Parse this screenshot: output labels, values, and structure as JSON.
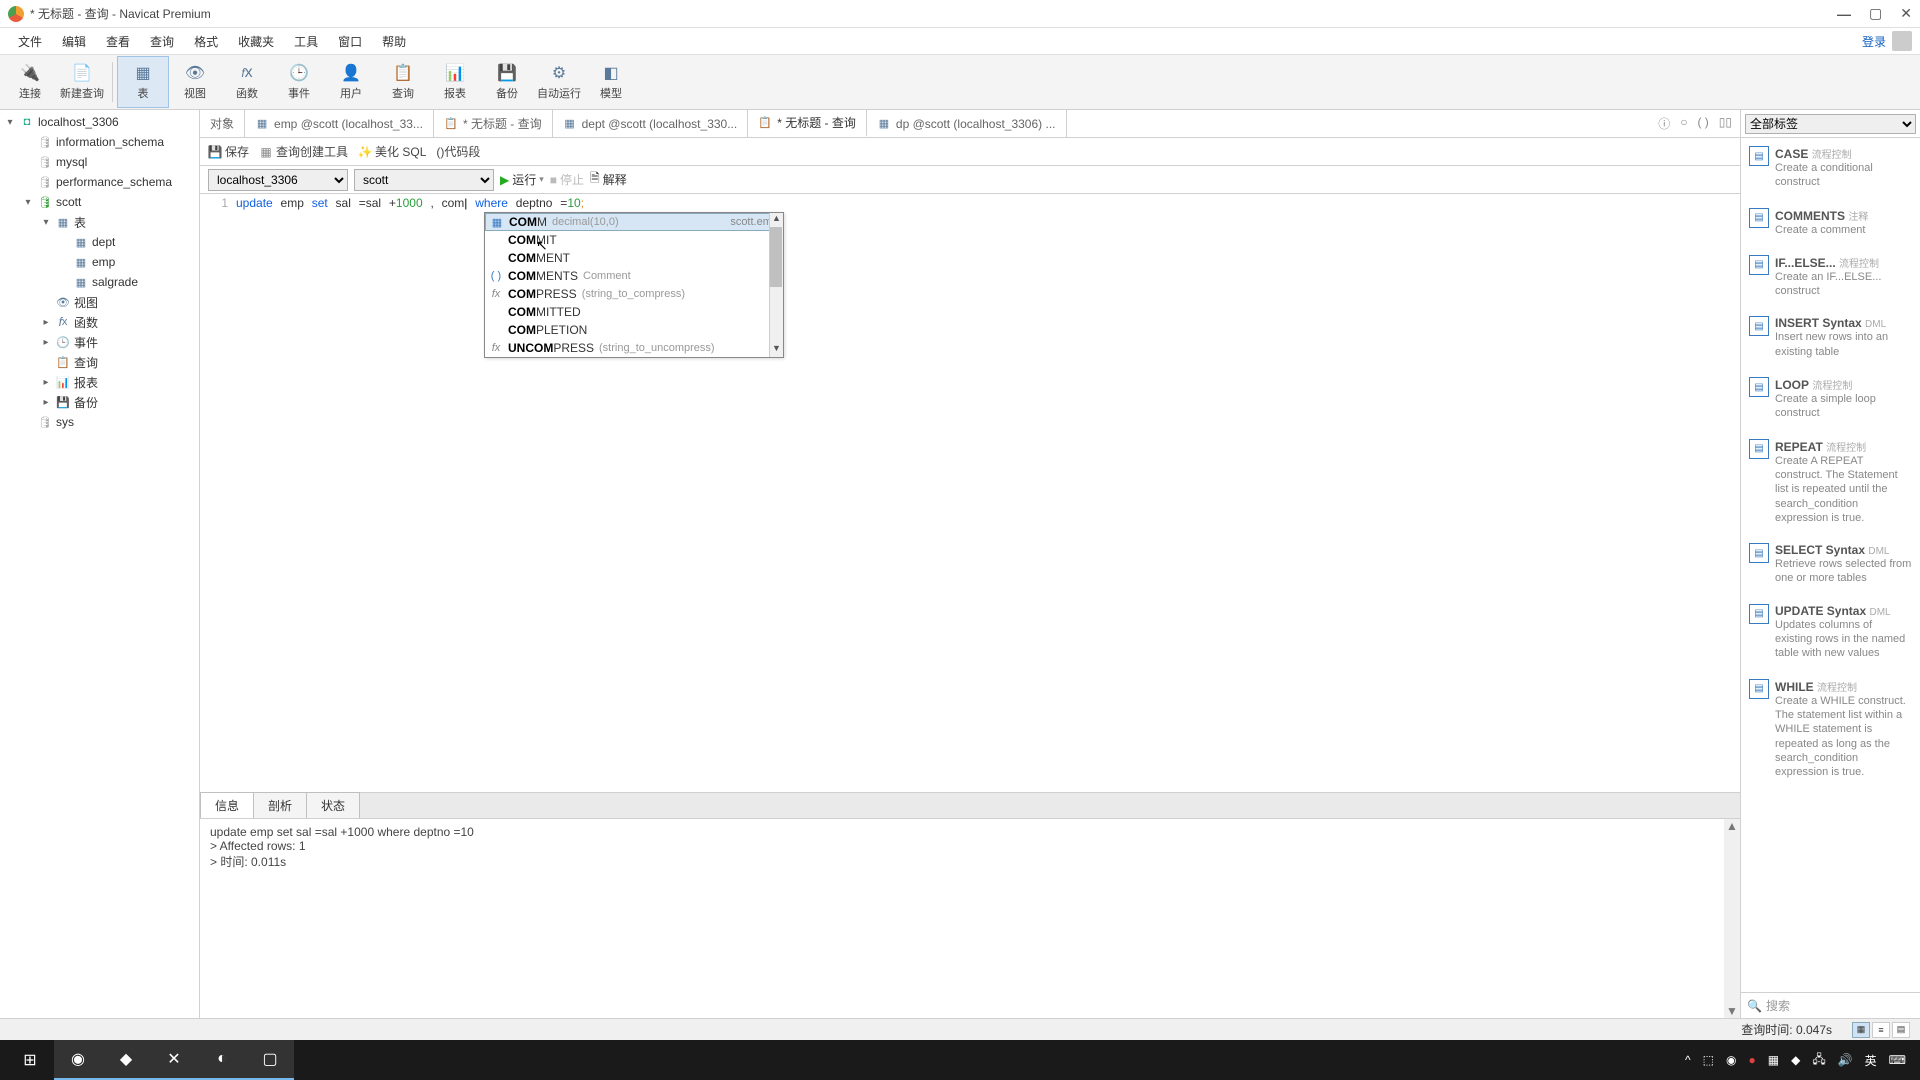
{
  "window": {
    "title": "* 无标题 - 查询 - Navicat Premium"
  },
  "menu": {
    "items": [
      "文件",
      "编辑",
      "查看",
      "查询",
      "格式",
      "收藏夹",
      "工具",
      "窗口",
      "帮助"
    ],
    "login": "登录"
  },
  "toolbar": {
    "connect": "连接",
    "new_query": "新建查询",
    "table": "表",
    "view": "视图",
    "fn": "函数",
    "event": "事件",
    "user": "用户",
    "query": "查询",
    "report": "报表",
    "backup": "备份",
    "auto": "自动运行",
    "model": "模型"
  },
  "tree": {
    "conn": "localhost_3306",
    "dbs": [
      "information_schema",
      "mysql",
      "performance_schema"
    ],
    "scott": "scott",
    "table": "表",
    "dept": "dept",
    "emp": "emp",
    "salgrade": "salgrade",
    "view": "视图",
    "fn": "函数",
    "event": "事件",
    "query": "查询",
    "report": "报表",
    "backup": "备份",
    "sys": "sys"
  },
  "tabs": {
    "objects": "对象",
    "emp": "emp @scott (localhost_33...",
    "untitled_q": "* 无标题 - 查询",
    "dept": "dept @scott (localhost_330...",
    "untitled_q2": "* 无标题 - 查询",
    "dp": "dp @scott (localhost_3306) ..."
  },
  "qbar": {
    "save": "保存",
    "builder": "查询创建工具",
    "beautify": "美化 SQL",
    "snippet": "()代码段"
  },
  "run": {
    "conn": "localhost_3306",
    "db": "scott",
    "run": "运行",
    "stop": "停止",
    "explain": "解释"
  },
  "sql": {
    "line": "1",
    "tokens": {
      "update": "update",
      "emp": "emp",
      "set": "set",
      "sal1": "sal",
      "eq1": "=sal",
      "plus": "+",
      "num": "1000",
      "comma": ",",
      "com": "com",
      "where": "where",
      "deptno": "deptno",
      "eq2": "=",
      "ten": "10",
      "semi": ";"
    }
  },
  "ac": {
    "match": "COM",
    "items": [
      {
        "icon": "col",
        "pre": "COM",
        "rest": "M",
        "hint": "decimal(10,0)",
        "right": "scott.emp"
      },
      {
        "icon": "kw",
        "pre": "COM",
        "rest": "MIT"
      },
      {
        "icon": "kw",
        "pre": "COM",
        "rest": "MENT"
      },
      {
        "icon": "paren",
        "pre": "COM",
        "rest": "MENTS",
        "hint": "Comment"
      },
      {
        "icon": "fx",
        "pre": "COM",
        "rest": "PRESS",
        "hint": "(string_to_compress)"
      },
      {
        "icon": "kw",
        "pre": "COM",
        "rest": "MITTED"
      },
      {
        "icon": "kw",
        "pre": "COM",
        "rest": "PLETION"
      },
      {
        "icon": "fx",
        "pre": "UNCOM",
        "rest": "PRESS",
        "hint": "(string_to_uncompress)"
      }
    ]
  },
  "result_tabs": {
    "info": "信息",
    "profile": "剖析",
    "status": "状态"
  },
  "msg": {
    "l1": "update emp set sal =sal +1000 where deptno =10",
    "l2": "> Affected rows: 1",
    "l3": "> 时间: 0.011s"
  },
  "snips": {
    "tags": "全部标签",
    "search": "搜索",
    "items": [
      {
        "t": "CASE",
        "c": "流程控制",
        "d": "Create a conditional construct"
      },
      {
        "t": "COMMENTS",
        "c": "注释",
        "d": "Create a comment"
      },
      {
        "t": "IF...ELSE...",
        "c": "流程控制",
        "d": "Create an IF...ELSE... construct"
      },
      {
        "t": "INSERT Syntax",
        "c": "DML",
        "d": "Insert new rows into an existing table"
      },
      {
        "t": "LOOP",
        "c": "流程控制",
        "d": "Create a simple loop construct"
      },
      {
        "t": "REPEAT",
        "c": "流程控制",
        "d": "Create A REPEAT construct. The Statement list is repeated until the search_condition expression is true."
      },
      {
        "t": "SELECT Syntax",
        "c": "DML",
        "d": "Retrieve rows selected from one or more tables"
      },
      {
        "t": "UPDATE Syntax",
        "c": "DML",
        "d": "Updates columns of existing rows in the named table with new values"
      },
      {
        "t": "WHILE",
        "c": "流程控制",
        "d": "Create a WHILE construct. The statement list within a WHILE statement is repeated as long as the search_condition expression is true."
      }
    ]
  },
  "status": {
    "qtime": "查询时间: 0.047s"
  },
  "tray": {
    "ime": "英",
    "kb": "⌨"
  }
}
